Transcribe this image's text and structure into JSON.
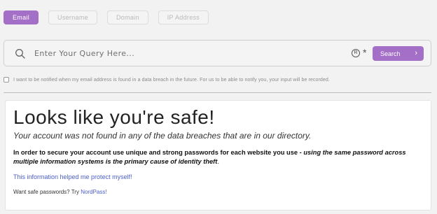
{
  "tabs": [
    {
      "label": "Email",
      "active": true
    },
    {
      "label": "Username",
      "active": false
    },
    {
      "label": "Domain",
      "active": false
    },
    {
      "label": "IP Address",
      "active": false
    }
  ],
  "search": {
    "placeholder": "Enter Your Query Here...",
    "button_label": "Search",
    "reg_symbol": "R",
    "asterisk": "*",
    "chevron": "›"
  },
  "notify": {
    "label": "I want to be notified when my email address is found in a data breach in the future. For us to be able to notify you, your input will be recorded.",
    "checked": false
  },
  "result": {
    "title": "Looks like you're safe!",
    "subtitle": "Your account was not found in any of the data breaches that are in our directory.",
    "advice_lead": "In order to secure your account use unique and strong passwords for each website you use - ",
    "advice_emphasis": "using the same password across multiple information systems is the primary cause of identity theft",
    "advice_tail": ".",
    "help_link": "This information helped me protect myself!",
    "passwords_prefix": "Want safe passwords? Try ",
    "passwords_link": "NordPass!"
  },
  "colors": {
    "accent": "#a46fc7",
    "link": "#4b5ec9",
    "background": "#f2f2f2"
  }
}
